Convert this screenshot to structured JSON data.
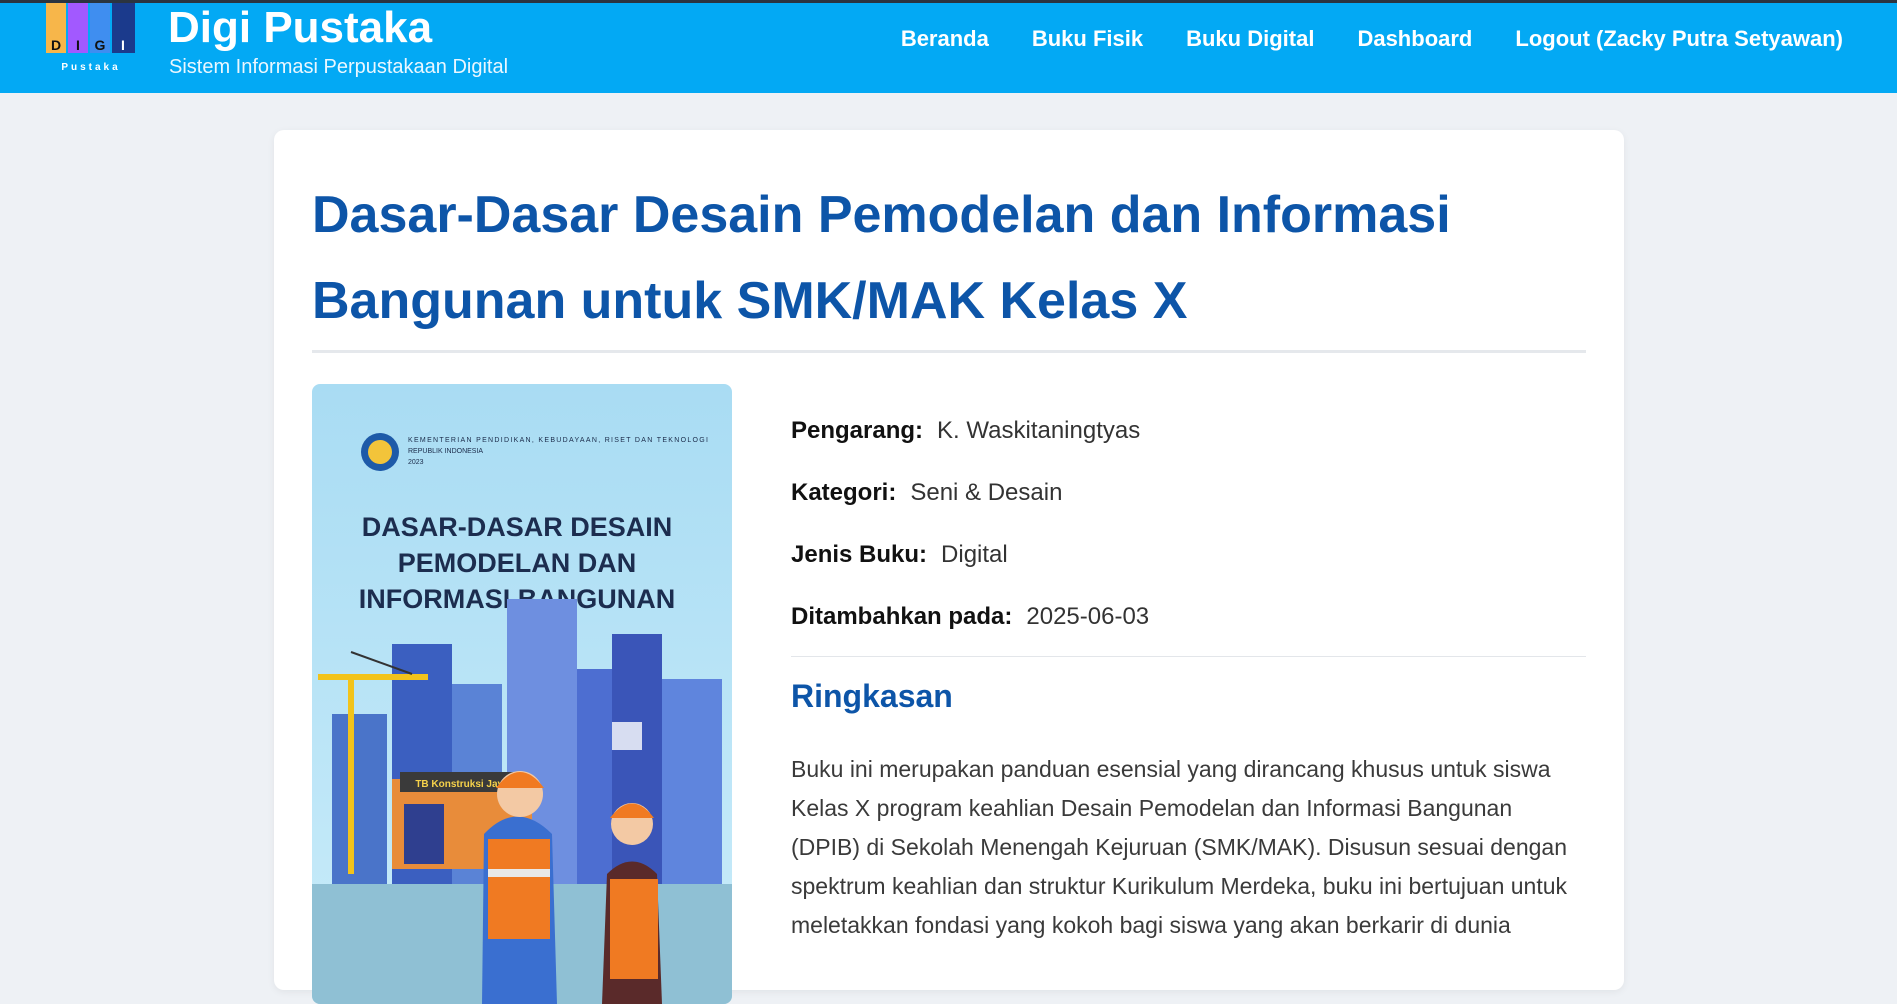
{
  "brand": {
    "title": "Digi Pustaka",
    "subtitle": "Sistem Informasi Perpustakaan Digital",
    "logo_text": "DIGI",
    "logo_subtext": "Pustaka"
  },
  "nav": {
    "items": [
      {
        "label": "Beranda"
      },
      {
        "label": "Buku Fisik"
      },
      {
        "label": "Buku Digital"
      },
      {
        "label": "Dashboard"
      },
      {
        "label": "Logout (Zacky Putra Setyawan)"
      }
    ]
  },
  "book": {
    "title": "Dasar-Dasar Desain Pemodelan dan Informasi Bangunan untuk SMK/MAK Kelas X",
    "cover": {
      "publisher": "KEMENTERIAN PENDIDIKAN, KEBUDAYAAN, RISET DAN TEKNOLOGI REPUBLIK INDONESIA 2023",
      "title_line1": "DASAR-DASAR DESAIN",
      "title_line2": "PEMODELAN DAN",
      "title_line3": "INFORMASI BANGUNAN",
      "sign_text": "TB Konstruksi Jaya"
    },
    "meta": [
      {
        "label": "Pengarang:",
        "value": "K. Waskitaningtyas"
      },
      {
        "label": "Kategori:",
        "value": "Seni & Desain"
      },
      {
        "label": "Jenis Buku:",
        "value": "Digital"
      },
      {
        "label": "Ditambahkan pada:",
        "value": "2025-06-03"
      }
    ],
    "summary_heading": "Ringkasan",
    "summary_text": "Buku ini merupakan panduan esensial yang dirancang khusus untuk siswa Kelas X program keahlian Desain Pemodelan dan Informasi Bangunan (DPIB) di Sekolah Menengah Kejuruan (SMK/MAK). Disusun sesuai dengan spektrum keahlian dan struktur Kurikulum Merdeka, buku ini bertujuan untuk meletakkan fondasi yang kokoh bagi siswa yang akan berkarir di dunia"
  },
  "colors": {
    "navbar": "#03a9f4",
    "title": "#0d55a8",
    "background": "#eef1f5"
  }
}
